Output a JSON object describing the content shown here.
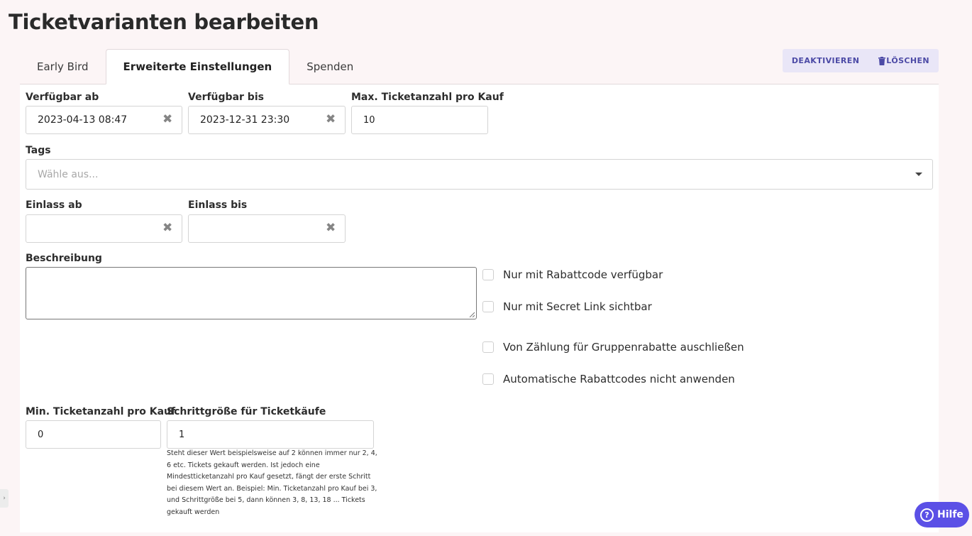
{
  "page": {
    "title": "Ticketvarianten bearbeiten"
  },
  "tabs": [
    {
      "label": "Early Bird",
      "active": false
    },
    {
      "label": "Erweiterte Einstellungen",
      "active": true
    },
    {
      "label": "Spenden",
      "active": false
    }
  ],
  "actions": {
    "deactivate": "DEAKTIVIEREN",
    "delete": "LÖSCHEN"
  },
  "form": {
    "available_from": {
      "label": "Verfügbar ab",
      "value": "2023-04-13 08:47"
    },
    "available_until": {
      "label": "Verfügbar bis",
      "value": "2023-12-31 23:30"
    },
    "max_tickets": {
      "label": "Max. Ticketanzahl pro Kauf",
      "value": "10"
    },
    "tags": {
      "label": "Tags",
      "placeholder": "Wähle aus..."
    },
    "entry_from": {
      "label": "Einlass ab",
      "value": ""
    },
    "entry_until": {
      "label": "Einlass bis",
      "value": ""
    },
    "description": {
      "label": "Beschreibung",
      "value": ""
    },
    "checkboxes": [
      {
        "label": "Nur mit Rabattcode verfügbar",
        "checked": false
      },
      {
        "label": "Nur mit Secret Link sichtbar",
        "checked": false
      },
      {
        "label": "Von Zählung für Gruppenrabatte auschließen",
        "checked": false
      },
      {
        "label": "Automatische Rabattcodes nicht anwenden",
        "checked": false
      }
    ],
    "min_tickets": {
      "label": "Min. Ticketanzahl pro Kauf",
      "value": "0"
    },
    "step_size": {
      "label": "Schrittgröße für Ticketkäufe",
      "value": "1",
      "help": "Steht dieser Wert beispielsweise auf 2 können immer nur 2, 4, 6 etc. Tickets gekauft werden. Ist jedoch eine Mindestticketanzahl pro Kauf gesetzt, fängt der erste Schritt bei diesem Wert an. Beispiel: Min. Ticketanzahl pro Kauf bei 3, und Schrittgröße bei 5, dann können 3, 8, 13, 18 ... Tickets gekauft werden"
    }
  },
  "help_button": {
    "label": "Hilfe"
  },
  "icons": {
    "clear": "close-icon",
    "caret": "chevron-down-icon",
    "trash": "trash-icon",
    "help": "question-circle-icon"
  },
  "colors": {
    "accent": "#5b50e6",
    "button_bg": "#e9e6f7",
    "button_text": "#4c4aa6",
    "page_bg": "#fcf5f6"
  }
}
